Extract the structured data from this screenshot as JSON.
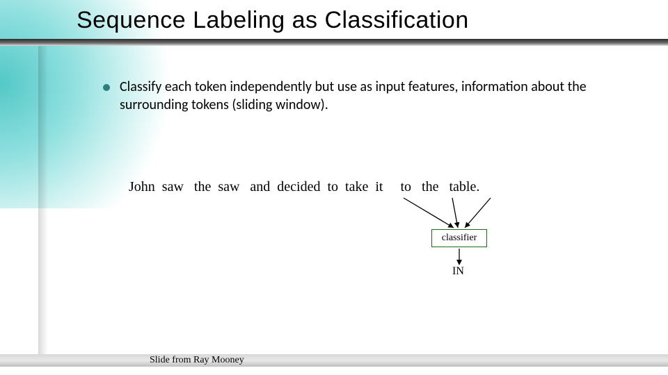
{
  "title": "Sequence Labeling as Classification",
  "bullet": "Classify each token independently but use as input features, information about the surrounding tokens (sliding window).",
  "sentence_tokens": [
    "John",
    "saw",
    "the",
    "saw",
    "and",
    "decided",
    "to",
    "take",
    "it",
    "to",
    "the",
    "table."
  ],
  "sentence_spaced": "John  saw   the  saw   and  decided  to  take  it     to   the   table.",
  "classifier_label": "classifier",
  "output_tag": "IN",
  "footer": "Slide from Ray Mooney",
  "colors": {
    "accent_teal": "#53c8c7",
    "bullet_dot": "#2f7f7f",
    "classifier_border": "#1a6a1a"
  }
}
